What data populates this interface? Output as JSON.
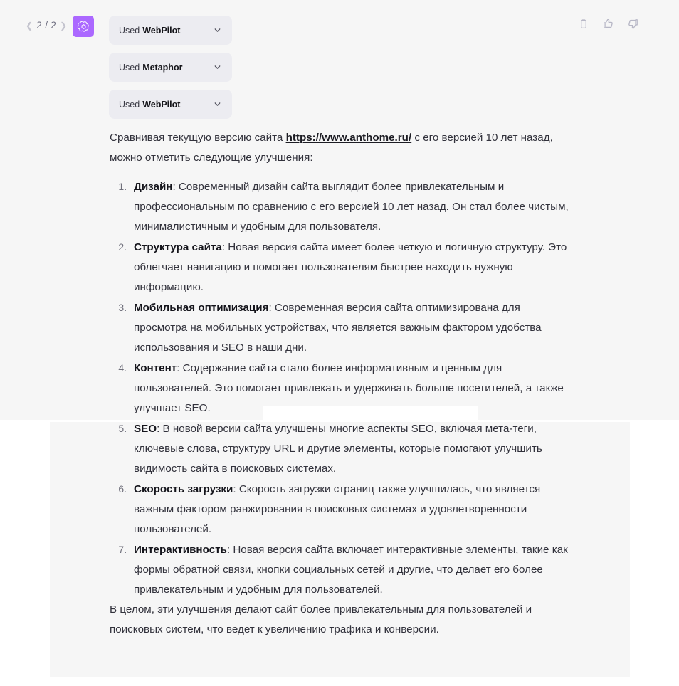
{
  "header": {
    "pagination": {
      "prev_icon": "chevron-left-icon",
      "text": "2 / 2",
      "next_icon": "chevron-right-icon"
    },
    "avatar": {
      "icon": "openai-logo-icon",
      "background_color": "#AB68FF"
    },
    "actions": [
      {
        "name": "copy-button",
        "icon": "clipboard-icon"
      },
      {
        "name": "thumbs-up-button",
        "icon": "thumbs-up-icon"
      },
      {
        "name": "thumbs-down-button",
        "icon": "thumbs-down-icon"
      }
    ]
  },
  "plugin_badges": [
    {
      "used_label": "Used",
      "plugin": "WebPilot",
      "chevron_icon": "chevron-down-icon"
    },
    {
      "used_label": "Used",
      "plugin": "Metaphor",
      "chevron_icon": "chevron-down-icon"
    },
    {
      "used_label": "Used",
      "plugin": "WebPilot",
      "chevron_icon": "chevron-down-icon"
    }
  ],
  "message": {
    "intro_before_link": "Сравнивая текущую версию сайта ",
    "link_text": "https://www.anthome.ru/",
    "intro_after_link": " с его версией 10 лет назад, можно отметить следующие улучшения:",
    "items": [
      {
        "term": "Дизайн",
        "text": ": Современный дизайн сайта выглядит более привлекательным и профессиональным по сравнению с его версией 10 лет назад. Он стал более чистым, минималистичным и удобным для пользователя."
      },
      {
        "term": "Структура сайта",
        "text": ": Новая версия сайта имеет более четкую и логичную структуру. Это облегчает навигацию и помогает пользователям быстрее находить нужную информацию."
      },
      {
        "term": "Мобильная оптимизация",
        "text": ": Современная версия сайта оптимизирована для просмотра на мобильных устройствах, что является важным фактором удобства использования и SEO в наши дни."
      },
      {
        "term": "Контент",
        "text": ": Содержание сайта стало более информативным и ценным для пользователей. Это помогает привлекать и удерживать больше посетителей, а также улучшает SEO."
      },
      {
        "term": "SEO",
        "text": ": В новой версии сайта улучшены многие аспекты SEO, включая мета-теги, ключевые слова, структуру URL и другие элементы, которые помогают улучшить видимость сайта в поисковых системах."
      },
      {
        "term": "Скорость загрузки",
        "text": ": Скорость загрузки страниц также улучшилась, что является важным фактором ранжирования в поисковых системах и удовлетворенности пользователей."
      },
      {
        "term": "Интерактивность",
        "text": ": Новая версия сайта включает интерактивные элементы, такие как формы обратной связи, кнопки социальных сетей и другие, что делает его более привлекательным и удобным для пользователей."
      }
    ],
    "closing": "В целом, эти улучшения делают сайт более привлекательным для пользователей и поисковых систем, что ведет к увеличению трафика и конверсии."
  },
  "colors": {
    "panel_background": "#F6F6F6",
    "badge_background": "#ECECF1",
    "avatar_purple": "#AB68FF",
    "body_text": "#32323C",
    "page_background": "#FFFFFF"
  }
}
